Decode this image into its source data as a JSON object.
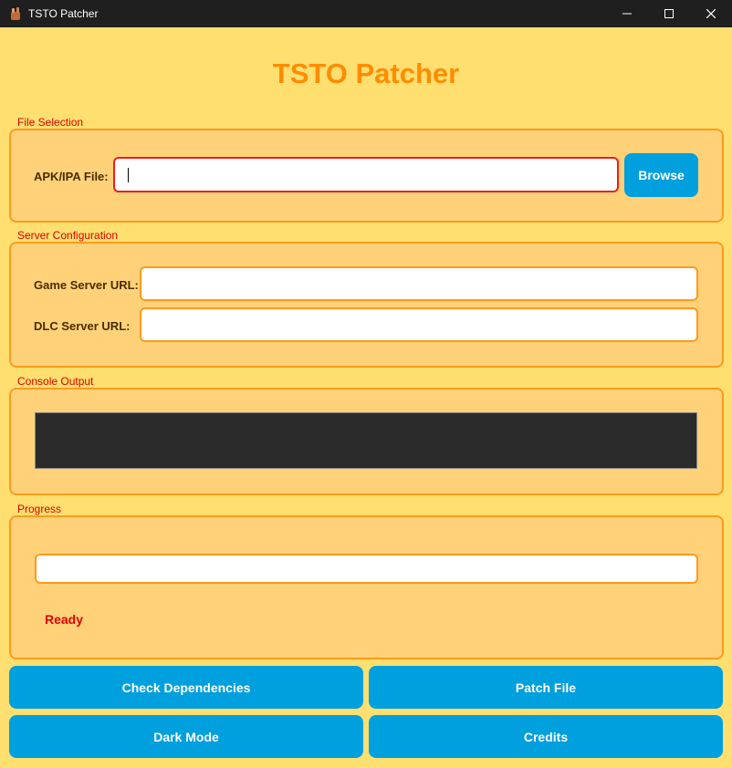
{
  "window": {
    "title": "TSTO Patcher"
  },
  "header": {
    "title": "TSTO Patcher"
  },
  "file_selection": {
    "group_label": "File Selection",
    "apk_label": "APK/IPA File:",
    "apk_value": "",
    "browse_label": "Browse"
  },
  "server_config": {
    "group_label": "Server Configuration",
    "game_label": "Game Server URL:",
    "game_value": "",
    "dlc_label": "DLC Server URL:",
    "dlc_value": ""
  },
  "console": {
    "group_label": "Console Output",
    "text": ""
  },
  "progress": {
    "group_label": "Progress",
    "value": 0,
    "status": "Ready"
  },
  "actions": {
    "check_deps": "Check Dependencies",
    "patch_file": "Patch File",
    "dark_mode": "Dark Mode",
    "credits": "Credits"
  },
  "colors": {
    "background": "#ffdf70",
    "panel": "#ffd27a",
    "border": "#ff9a1a",
    "title": "#ff8c00",
    "label": "#dd0000",
    "button": "#009fde",
    "console_bg": "#2a2a2a"
  }
}
